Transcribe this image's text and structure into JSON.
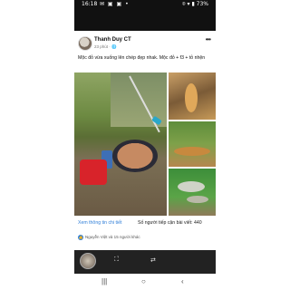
{
  "status": {
    "time": "16:18",
    "notifications": "✉ ▣ ▣ •",
    "indicators": "⌾ ▾ ▮ 73%"
  },
  "post": {
    "author": "Thanh Duy CT",
    "meta": "23 phút · 🌐",
    "more": "•••",
    "caption": "Mộc đỏ vừa xuống lên chép đẹp nhak. Mộc đỏ + f3 + tỏ nhện"
  },
  "footer": {
    "details_link": "Xem thông tin chi tiết",
    "reach": "Số người tiếp cận bài viết: 440",
    "reactions": "Nguyễn Việt và 15 người khác"
  },
  "dock": {
    "expand_icon": "⛶",
    "unlink_icon": "⇄"
  },
  "navbar": {
    "recents": "|||",
    "home": "○",
    "back": "‹"
  },
  "colors": {
    "link": "#2f7ed8",
    "dock": "#222222"
  }
}
